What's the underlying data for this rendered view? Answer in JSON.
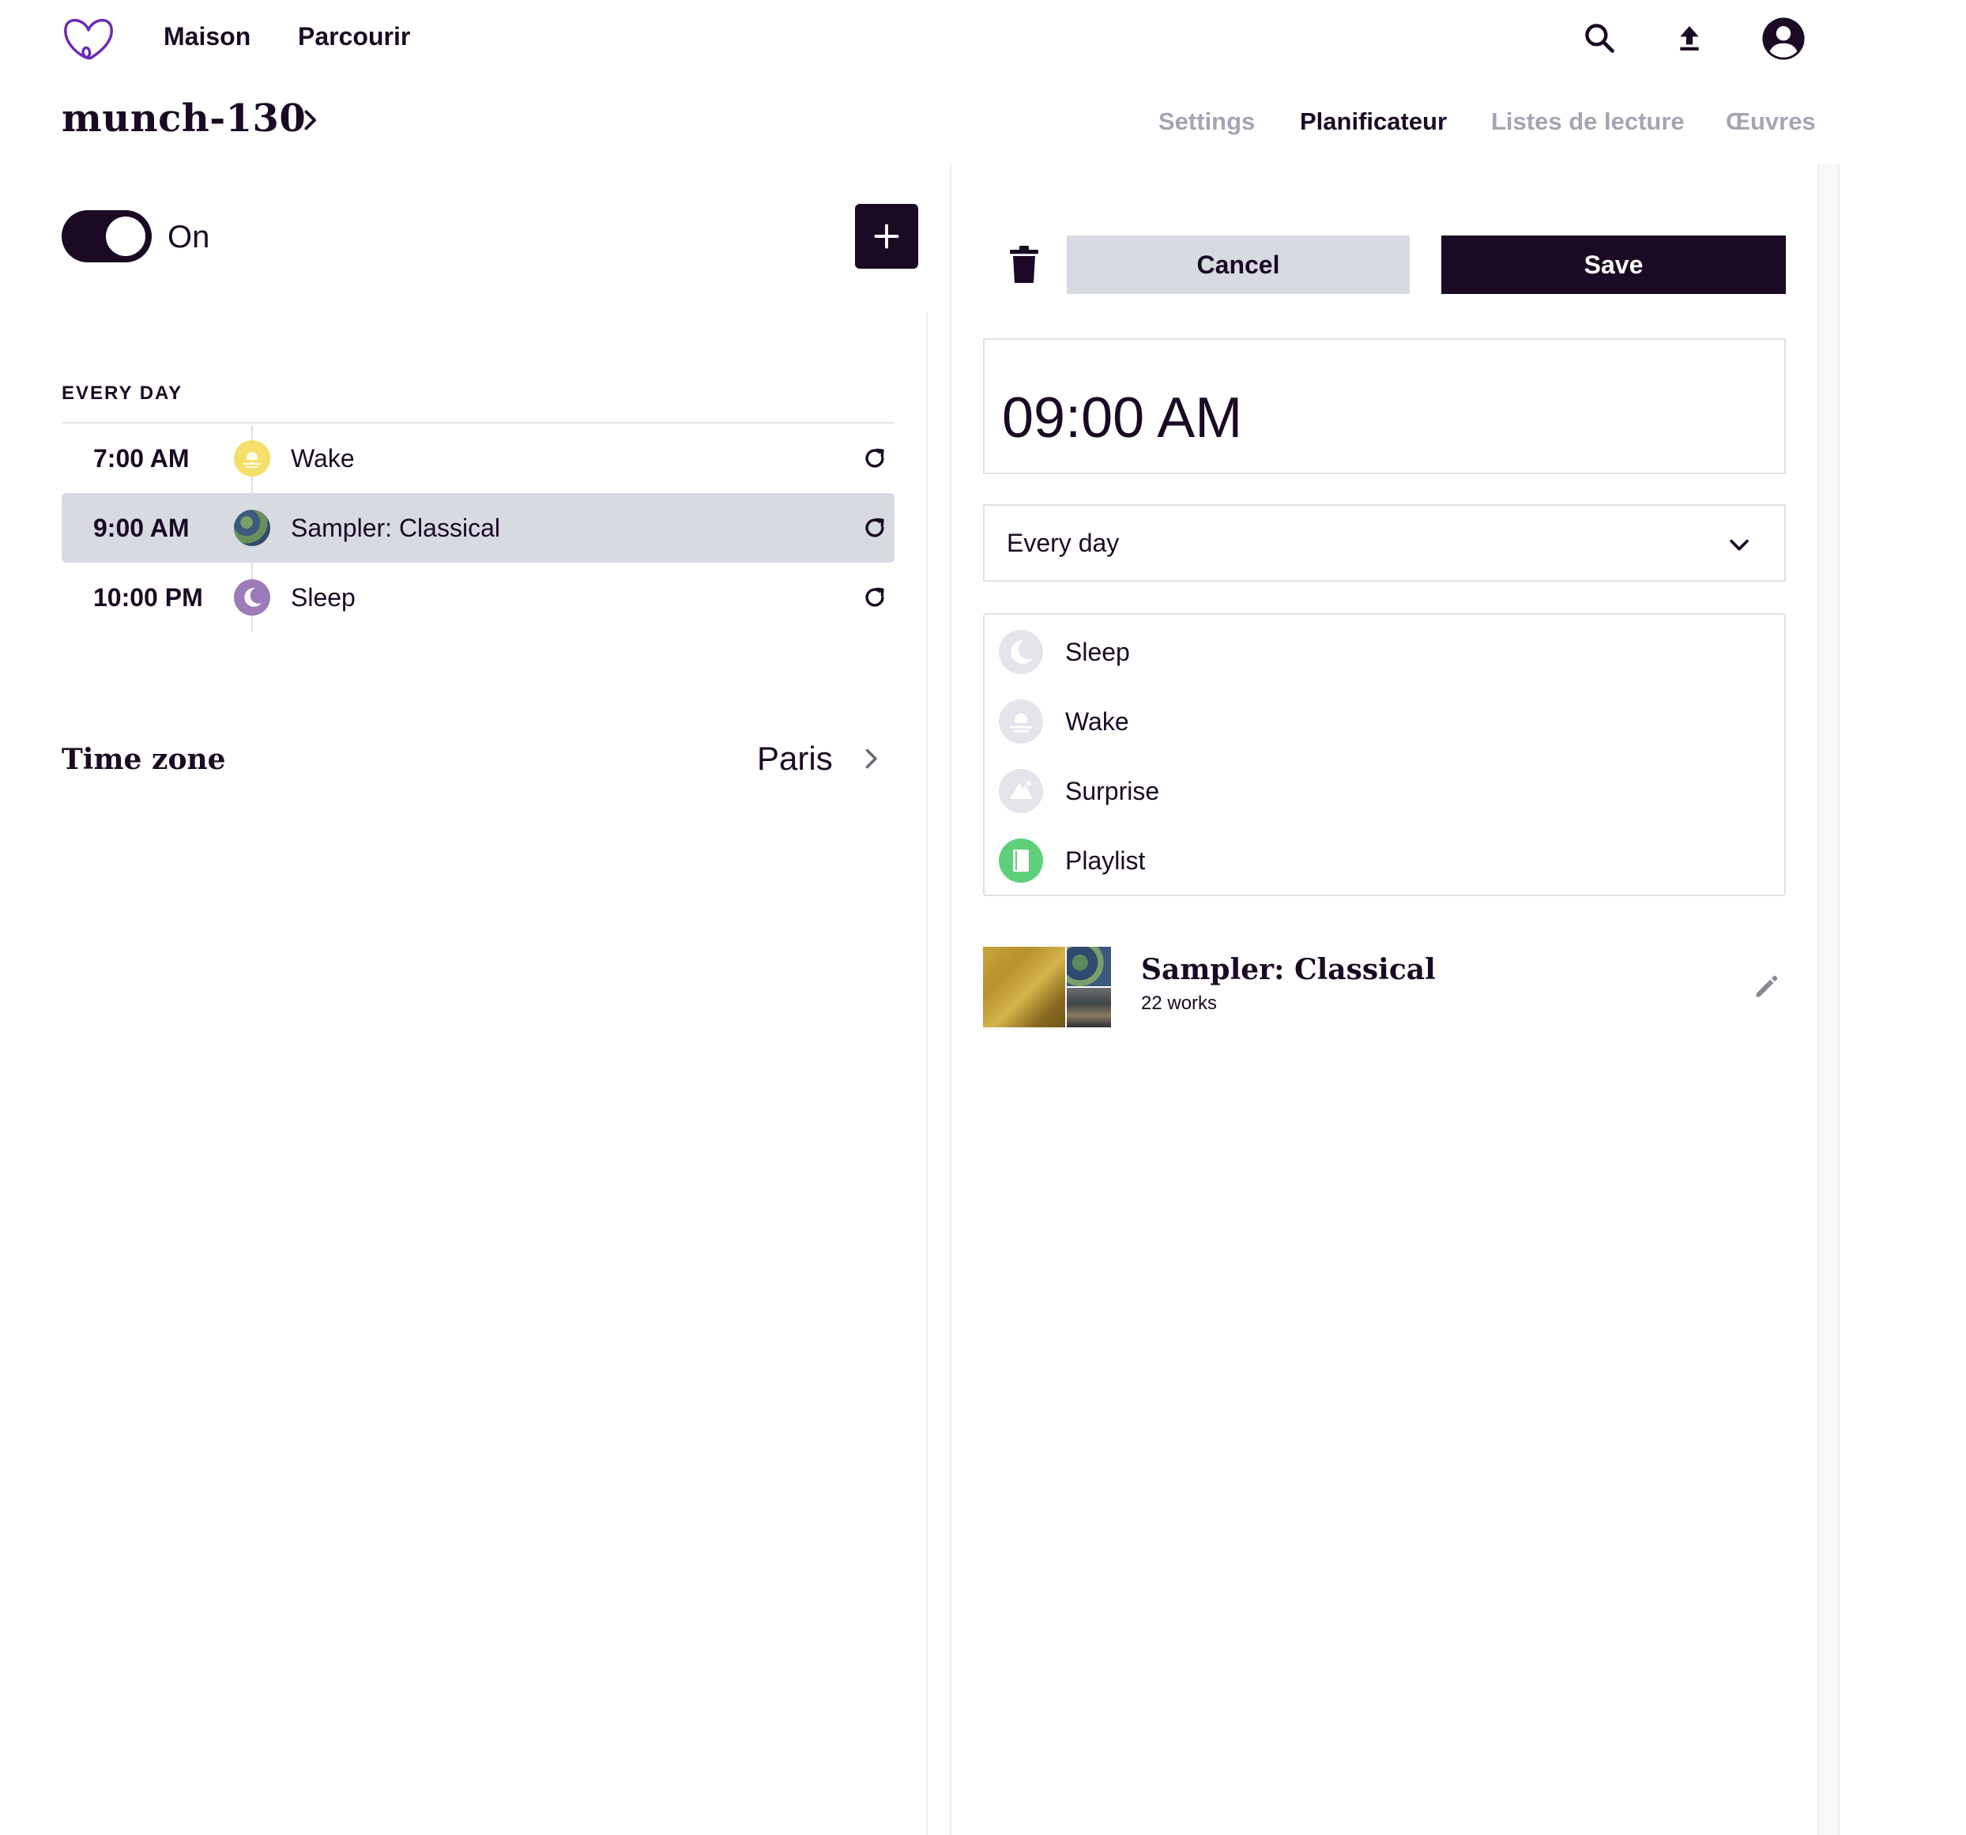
{
  "nav": {
    "links": [
      "Maison",
      "Parcourir"
    ]
  },
  "device": {
    "name": "munch-130"
  },
  "tabs": [
    {
      "label": "Settings",
      "active": false
    },
    {
      "label": "Planificateur",
      "active": true
    },
    {
      "label": "Listes de lecture",
      "active": false
    },
    {
      "label": "Œuvres",
      "active": false
    }
  ],
  "scheduler": {
    "enabled": true,
    "toggle_label": "On",
    "section_label": "EVERY DAY",
    "entries": [
      {
        "time": "7:00 AM",
        "title": "Wake",
        "icon": "sunrise-icon",
        "selected": false
      },
      {
        "time": "9:00 AM",
        "title": "Sampler: Classical",
        "icon": "artwork-thumbnail",
        "selected": true
      },
      {
        "time": "10:00 PM",
        "title": "Sleep",
        "icon": "moon-icon",
        "selected": false
      }
    ],
    "timezone_label": "Time zone",
    "timezone_value": "Paris"
  },
  "editor": {
    "cancel_label": "Cancel",
    "save_label": "Save",
    "time_value": "09:00 AM",
    "repeat_value": "Every day",
    "types": [
      {
        "label": "Sleep",
        "icon": "moon-icon"
      },
      {
        "label": "Wake",
        "icon": "sunrise-icon"
      },
      {
        "label": "Surprise",
        "icon": "surprise-icon"
      },
      {
        "label": "Playlist",
        "icon": "playlist-icon",
        "selected": true
      }
    ],
    "playlist": {
      "title": "Sampler: Classical",
      "count": "22 works"
    }
  },
  "colors": {
    "primary": "#1a0a24",
    "selected_row": "#d8dae2",
    "wake_yellow": "#f5df6a",
    "sleep_purple": "#9b7bb8",
    "playlist_green": "#5fd07a",
    "logo_purple": "#6b2bb8"
  }
}
